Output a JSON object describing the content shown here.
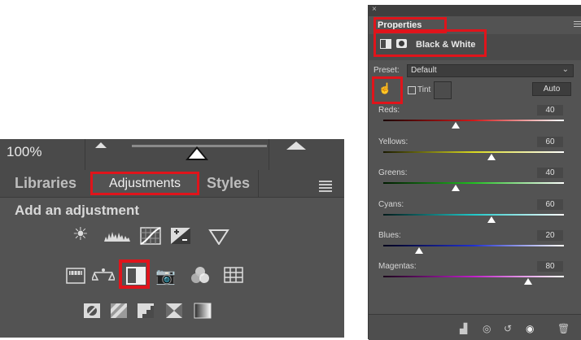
{
  "adjustments_panel": {
    "zoom_value": "100%",
    "tabs": [
      {
        "label": "Libraries"
      },
      {
        "label": "Adjustments"
      },
      {
        "label": "Styles"
      }
    ],
    "add_title": "Add an adjustment",
    "icons": {
      "row1": [
        "brightness-contrast-icon",
        "levels-icon",
        "curves-icon",
        "exposure-icon",
        "vibrance-icon"
      ],
      "row2": [
        "hue-saturation-icon",
        "color-balance-icon",
        "black-white-icon",
        "photo-filter-icon",
        "channel-mixer-icon",
        "color-lookup-icon"
      ],
      "row3": [
        "invert-icon",
        "posterize-icon",
        "threshold-icon",
        "selective-color-icon",
        "gradient-map-icon"
      ]
    },
    "highlight_color": "#e0141b"
  },
  "properties_panel": {
    "tab_label": "Properties",
    "title": "Black & White",
    "preset_label": "Preset:",
    "preset_value": "Default",
    "tint_label": "Tint",
    "auto_label": "Auto",
    "sliders": [
      {
        "label": "Reds:",
        "value": "40",
        "level": 40
      },
      {
        "label": "Yellows:",
        "value": "60",
        "level": 60
      },
      {
        "label": "Greens:",
        "value": "40",
        "level": 40
      },
      {
        "label": "Cyans:",
        "value": "60",
        "level": 60
      },
      {
        "label": "Blues:",
        "value": "20",
        "level": 20
      },
      {
        "label": "Magentas:",
        "value": "80",
        "level": 80
      }
    ],
    "footer_icons": [
      "clip-to-layer-icon",
      "view-previous-icon",
      "reset-icon",
      "visibility-icon",
      "trash-icon"
    ]
  }
}
